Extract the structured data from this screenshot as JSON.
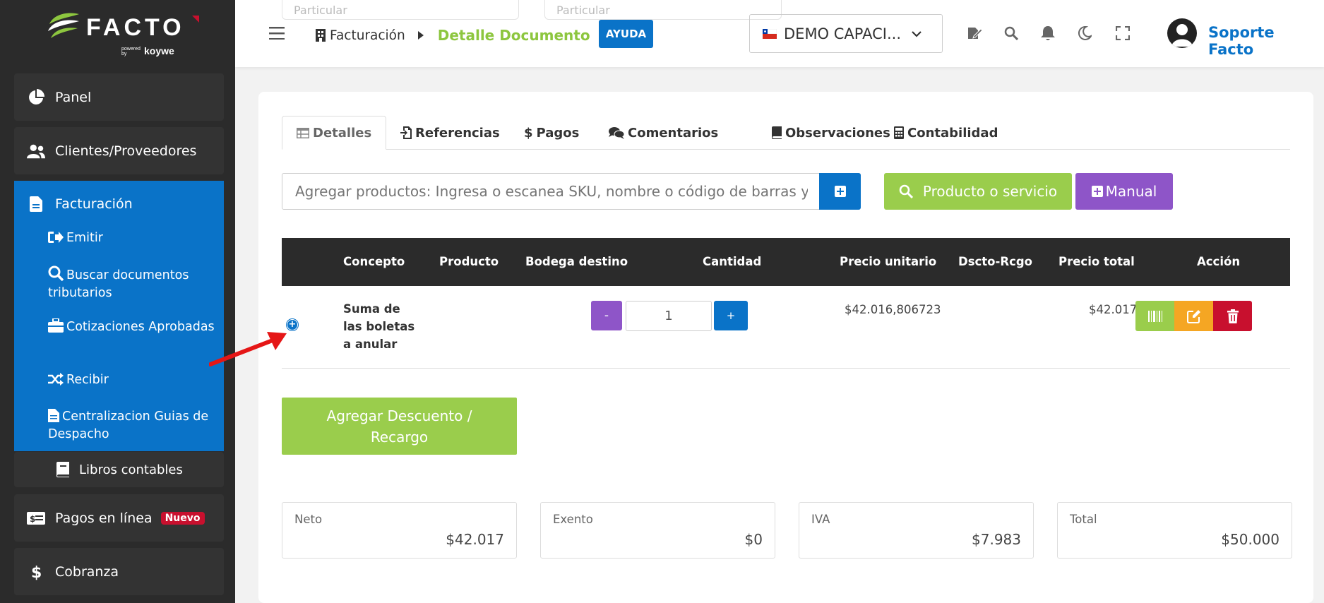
{
  "brand": {
    "name": "FACTO",
    "powered": "powered by",
    "by": "koywe"
  },
  "sidebar": {
    "items": [
      {
        "label": "Panel"
      },
      {
        "label": "Clientes/Proveedores"
      },
      {
        "label": "Facturación"
      },
      {
        "label": "Libros contables"
      },
      {
        "label": "Pagos en línea",
        "badge": "Nuevo"
      },
      {
        "label": "Cobranza"
      }
    ],
    "subitems": [
      {
        "label": "Emitir"
      },
      {
        "label": "Buscar documentos tributarios"
      },
      {
        "label": "Cotizaciones Aprobadas"
      },
      {
        "label": "Recibir"
      },
      {
        "label": "Centralizacion Guias de Despacho"
      }
    ]
  },
  "topbar": {
    "ghost_1": "Particular",
    "ghost_2": "Particular",
    "breadcrumb_root": "Facturación",
    "breadcrumb_current": "Detalle Documento",
    "help": "AYUDA",
    "company": "DEMO CAPACI...",
    "user": "Soporte Facto"
  },
  "tabs": [
    {
      "label": "Detalles",
      "icon": "table-icon",
      "active": true
    },
    {
      "label": "Referencias",
      "icon": "file-import-icon"
    },
    {
      "label": "Pagos",
      "icon": "dollar-icon"
    },
    {
      "label": "Comentarios",
      "icon": "comments-icon"
    },
    {
      "label": "Observaciones",
      "icon": "book-icon"
    },
    {
      "label": "Contabilidad",
      "icon": "calculator-icon"
    }
  ],
  "product_search": {
    "placeholder": "Agregar productos: Ingresa o escanea SKU, nombre o código de barras y",
    "btn_search": "Producto o servicio",
    "btn_manual": "Manual"
  },
  "table": {
    "headers": [
      "Concepto",
      "Producto",
      "Bodega destino",
      "Cantidad",
      "Precio unitario",
      "Dscto-Rcgo",
      "Precio total",
      "Acción"
    ],
    "row": {
      "concept": "Suma de las boletas a anular",
      "quantity": "1",
      "minus": "-",
      "plus": "+",
      "unit_price": "$42.016,806723",
      "total_price": "$42.017"
    }
  },
  "discount_button": "Agregar Descuento / Recargo",
  "totals": [
    {
      "label": "Neto",
      "value": "$42.017"
    },
    {
      "label": "Exento",
      "value": "$0"
    },
    {
      "label": "IVA",
      "value": "$7.983"
    },
    {
      "label": "Total",
      "value": "$50.000"
    }
  ],
  "colors": {
    "primary": "#0a73c8",
    "green": "#9acd4c",
    "purple": "#8e55c8",
    "orange": "#f5a623",
    "red": "#c8102e",
    "dark": "#2b2b2b"
  }
}
